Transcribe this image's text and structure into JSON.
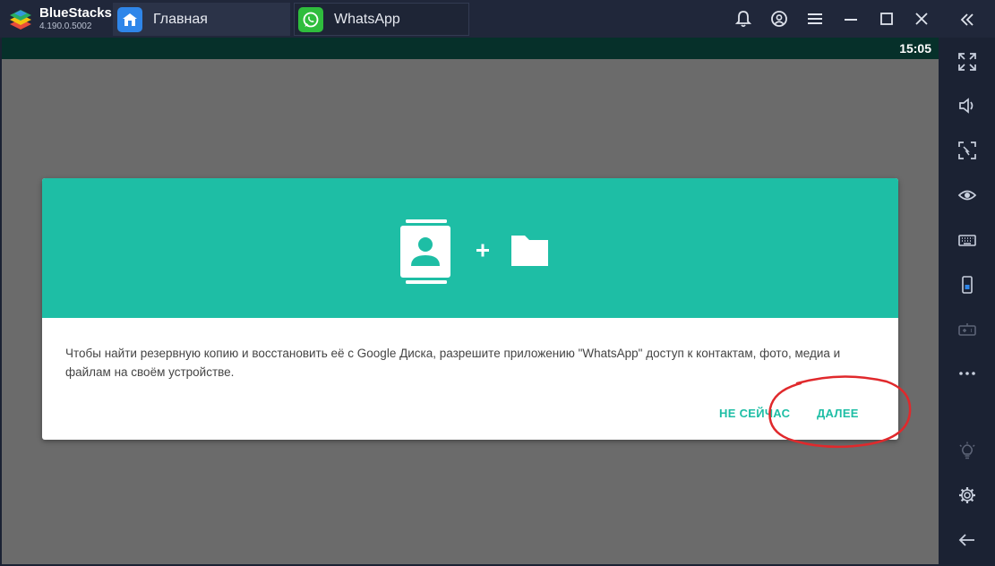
{
  "app": {
    "brand_name": "BlueStacks",
    "version": "4.190.0.5002"
  },
  "tabs": [
    {
      "label": "Главная",
      "icon": "home-icon",
      "color": "#2f86e9"
    },
    {
      "label": "WhatsApp",
      "icon": "whatsapp-icon",
      "color": "#2fbd3d"
    }
  ],
  "title_controls": [
    "bell-icon",
    "account-icon",
    "menu-icon",
    "maximize-icon",
    "close-icon"
  ],
  "status_bar": {
    "time": "15:05"
  },
  "dialog": {
    "header_color": "#1ebea5",
    "header_icons": [
      "contacts-icon",
      "plus-icon",
      "folder-icon"
    ],
    "message": "Чтобы найти резервную копию и восстановить её с Google Диска, разрешите приложению \"WhatsApp\" доступ к контактам, фото, медиа и файлам на своём устройстве.",
    "buttons": {
      "not_now": "НЕ СЕЙЧАС",
      "next": "ДАЛЕЕ"
    },
    "highlight_color": "#e0292c"
  },
  "sidebar": {
    "items": [
      "fullscreen-icon",
      "volume-icon",
      "screenshot-icon",
      "eye-icon",
      "keyboard-icon",
      "phone-icon",
      "gamepad-icon",
      "more-icon",
      "light-icon",
      "settings-icon",
      "back-icon"
    ]
  }
}
